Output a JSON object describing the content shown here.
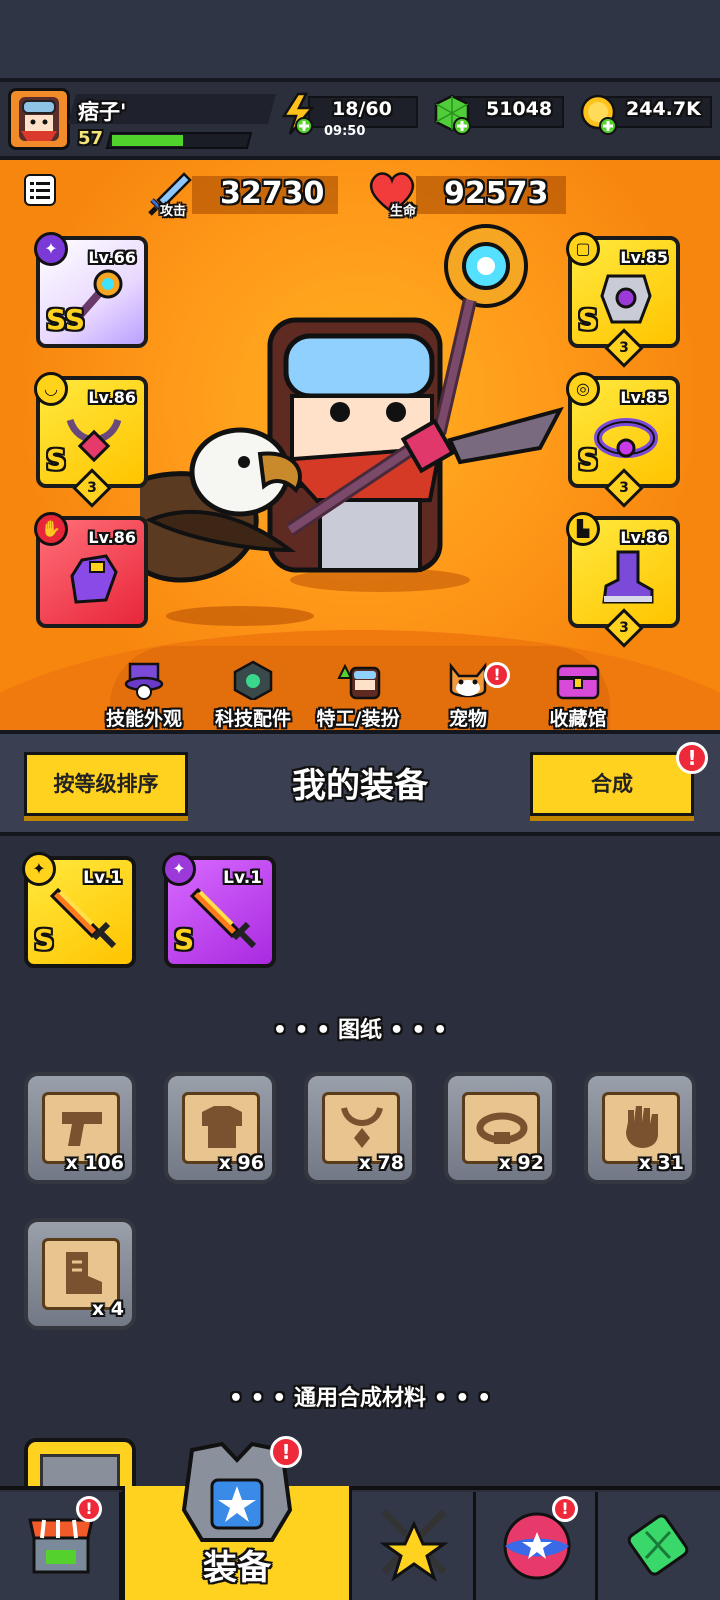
{
  "player": {
    "name": "痞子'",
    "level": "57",
    "xp_fraction": 0.5
  },
  "resources": {
    "energy": {
      "value": "18/60",
      "timer": "09:50"
    },
    "gems": {
      "value": "51048"
    },
    "gold": {
      "value": "244.7K"
    }
  },
  "stats": {
    "attack": {
      "label": "攻击",
      "value": "32730"
    },
    "hp": {
      "label": "生命",
      "value": "92573"
    }
  },
  "equipped": {
    "left": [
      {
        "level": "Lv.66",
        "grade": "SS",
        "slot": "weapon",
        "stars": ""
      },
      {
        "level": "Lv.86",
        "grade": "S",
        "slot": "necklace",
        "stars": "3"
      },
      {
        "level": "Lv.86",
        "grade": "",
        "slot": "gloves",
        "stars": ""
      }
    ],
    "right": [
      {
        "level": "Lv.85",
        "grade": "S",
        "slot": "armor",
        "stars": "3"
      },
      {
        "level": "Lv.85",
        "grade": "S",
        "slot": "belt",
        "stars": "3"
      },
      {
        "level": "Lv.86",
        "grade": "",
        "slot": "boots",
        "stars": "3"
      }
    ]
  },
  "nav": [
    "技能外观",
    "科技配件",
    "特工/装扮",
    "宠物",
    "收藏馆"
  ],
  "equipment_section": {
    "sort_label": "按等级排序",
    "title": "我的装备",
    "merge_label": "合成",
    "alert": "!"
  },
  "owned_items": [
    {
      "level": "Lv.1",
      "grade": "S",
      "color": "#ffd21f"
    },
    {
      "level": "Lv.1",
      "grade": "S",
      "color": "#b62ce8"
    }
  ],
  "blueprints": {
    "title": "• • •  图纸  • • •",
    "items": [
      {
        "icon": "pistol-icon",
        "count": "x 106"
      },
      {
        "icon": "armor-icon",
        "count": "x 96"
      },
      {
        "icon": "necklace-icon",
        "count": "x 78"
      },
      {
        "icon": "belt-icon",
        "count": "x 92"
      },
      {
        "icon": "glove-icon",
        "count": "x 31"
      },
      {
        "icon": "boot-icon",
        "count": "x 4"
      }
    ]
  },
  "materials": {
    "title": "• • •  通用合成材料  • • •"
  },
  "bottom_nav": {
    "active_label": "装备"
  },
  "colors": {
    "accent": "#ffd21f",
    "orange": "#ff9a1a",
    "alert": "#ee2a3a",
    "purple": "#b62ce8"
  }
}
